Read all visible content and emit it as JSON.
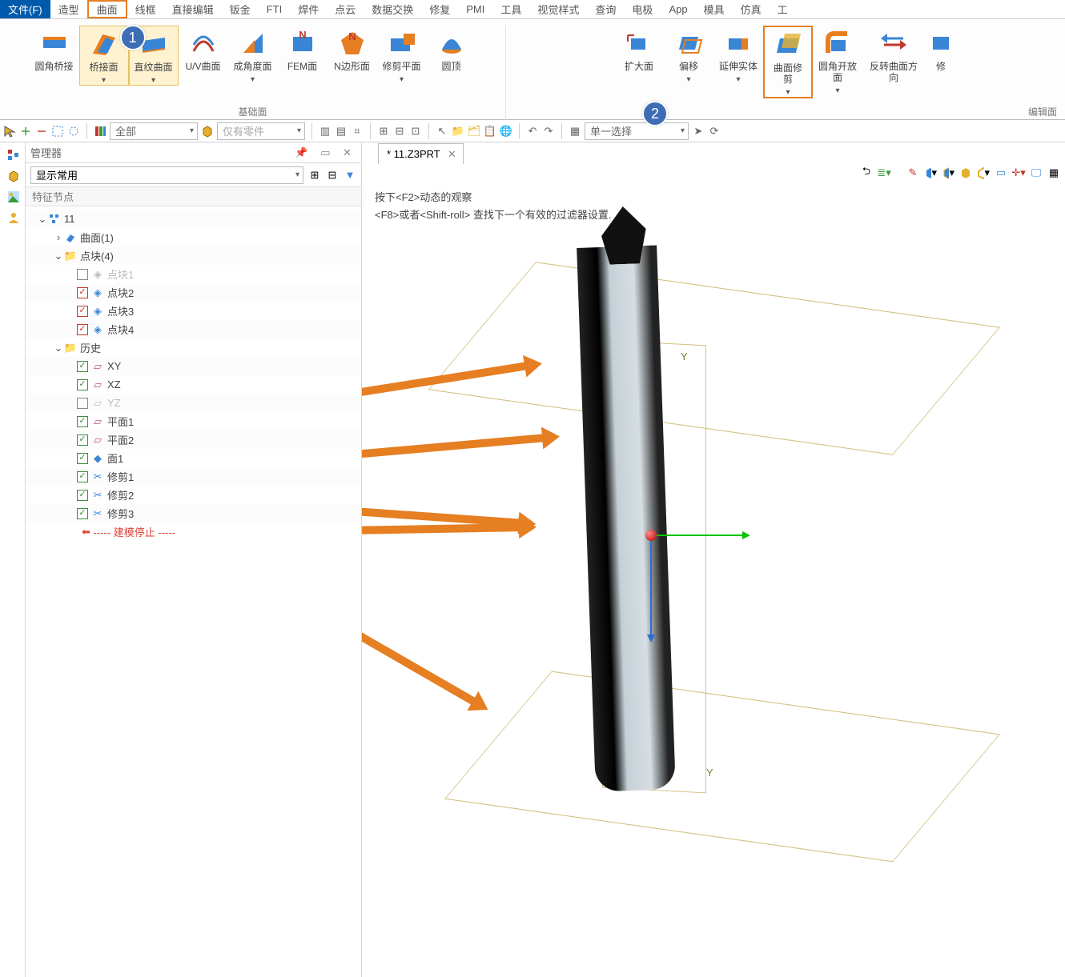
{
  "menu": {
    "file": "文件(F)",
    "items": [
      "造型",
      "曲面",
      "线框",
      "直接编辑",
      "钣金",
      "FTI",
      "焊件",
      "点云",
      "数据交换",
      "修复",
      "PMI",
      "工具",
      "视觉样式",
      "查询",
      "电极",
      "App",
      "模具",
      "仿真",
      "工"
    ],
    "active_index": 1
  },
  "ribbon": {
    "groups": {
      "base": "基础面",
      "edit": "编辑面"
    },
    "buttons": [
      {
        "label": "圆角桥接",
        "icon": "bridge"
      },
      {
        "label": "桥接面",
        "icon": "loft",
        "sel": true,
        "hasDrop": true
      },
      {
        "label": "直纹曲面",
        "icon": "ruled",
        "sel": true,
        "hasDrop": true
      },
      {
        "label": "U/V曲面",
        "icon": "uv"
      },
      {
        "label": "成角度面",
        "icon": "angle",
        "hasDrop": true
      },
      {
        "label": "FEM面",
        "icon": "fem"
      },
      {
        "label": "N边形面",
        "icon": "nside"
      },
      {
        "label": "修剪平面",
        "icon": "trimplane",
        "hasDrop": true
      },
      {
        "label": "圆顶",
        "icon": "dome"
      },
      {
        "label": "扩大面",
        "icon": "enlarge"
      },
      {
        "label": "偏移",
        "icon": "offset",
        "hasDrop": true
      },
      {
        "label": "延伸实体",
        "icon": "extend",
        "hasDrop": true
      },
      {
        "label": "曲面修剪",
        "icon": "surftrim",
        "box": true,
        "hasDrop": true
      },
      {
        "label": "圆角开放面",
        "icon": "fillet",
        "hasDrop": true
      },
      {
        "label": "反转曲面方向",
        "icon": "flip"
      },
      {
        "label": "修",
        "icon": "cut"
      }
    ]
  },
  "badges": {
    "b1": "1",
    "b2": "2"
  },
  "toolbar2": {
    "filter_all": "全部",
    "parts_only": "仅有零件",
    "select_mode": "单一选择"
  },
  "doc_tab": {
    "name": "* 11.Z3PRT"
  },
  "manager": {
    "title": "管理器",
    "display": "显示常用",
    "section": "特征节点",
    "root": "11",
    "surface": "曲面(1)",
    "blocks_group": "点块(4)",
    "blocks": [
      "点块1",
      "点块2",
      "点块3",
      "点块4"
    ],
    "history": "历史",
    "hist_items": [
      "XY",
      "XZ",
      "YZ",
      "平面1",
      "平面2",
      "面1",
      "修剪1",
      "修剪2",
      "修剪3"
    ],
    "stopline": "----- 建模停止 -----"
  },
  "viewport": {
    "hint1": "按下<F2>动态的观察",
    "hint2": "<F8>或者<Shift-roll> 查找下一个有效的过滤器设置.",
    "axis_y": "Y"
  }
}
